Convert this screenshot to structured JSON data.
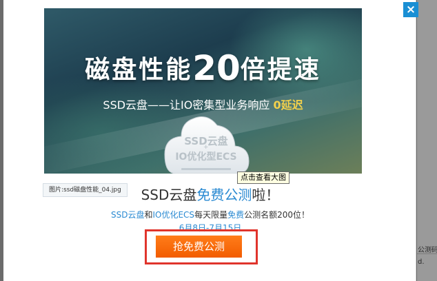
{
  "close_label": "×",
  "banner": {
    "title_prefix": "磁盘性能",
    "title_number": "20",
    "title_suffix": "倍提速",
    "subtitle_main": "SSD云盘——让IO密集型业务响应",
    "subtitle_accent": "0延迟",
    "cloud_line1": "SSD云盘",
    "cloud_plus": "+",
    "cloud_line2": "IO优化型ECS"
  },
  "tooltip": "点击查看大图",
  "image_caption": "图片:ssd磁盘性能_04.jpg",
  "headline": {
    "part1": "SSD云盘",
    "part2": "免费公测",
    "part3": "啦！"
  },
  "description": {
    "p1": "SSD云盘",
    "p2": "和",
    "p3": "IO优化ECS",
    "p4": "每天限量",
    "p5": "免费",
    "p6": "公测名额200位！"
  },
  "dates": "6月8日-7月15日",
  "cta_label": "抢免费公测",
  "background_page": {
    "line1": "公测码",
    "line2": "d."
  },
  "colors": {
    "accent_blue": "#2a8ad2",
    "cta_orange": "#f25c00",
    "highlight_red": "#e0342c",
    "close_blue": "#1a8fd4"
  }
}
